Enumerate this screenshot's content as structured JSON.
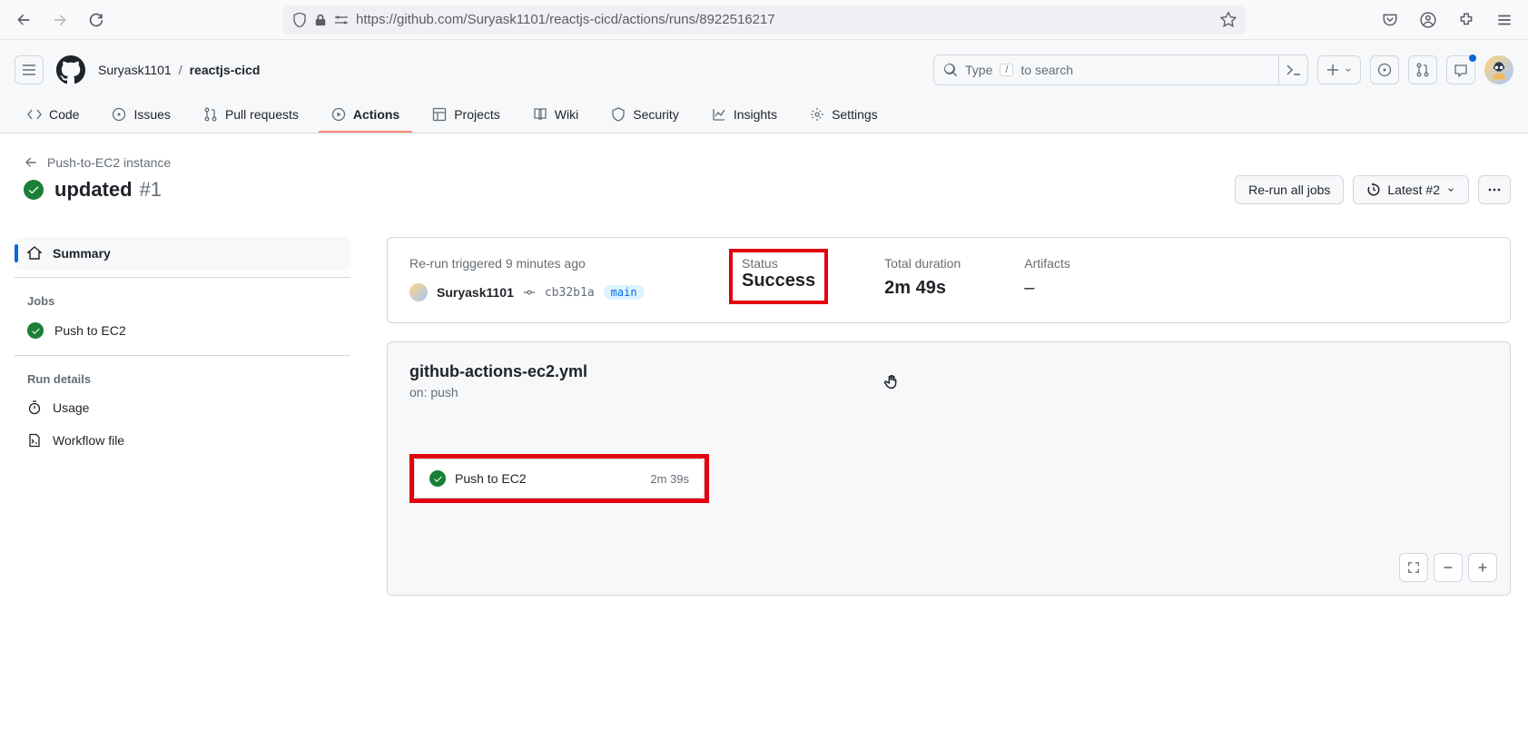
{
  "browser": {
    "url": "https://github.com/Suryask1101/reactjs-cicd/actions/runs/8922516217"
  },
  "breadcrumb": {
    "owner": "Suryask1101",
    "sep": "/",
    "repo": "reactjs-cicd"
  },
  "search": {
    "prefix": "Type",
    "key": "/",
    "suffix": "to search"
  },
  "repo_nav": {
    "code": "Code",
    "issues": "Issues",
    "pulls": "Pull requests",
    "actions": "Actions",
    "projects": "Projects",
    "wiki": "Wiki",
    "security": "Security",
    "insights": "Insights",
    "settings": "Settings"
  },
  "workflow_back": "Push-to-EC2 instance",
  "run": {
    "title": "updated",
    "number": "#1",
    "rerun_btn": "Re-run all jobs",
    "latest_btn": "Latest #2"
  },
  "sidebar": {
    "summary": "Summary",
    "jobs_heading": "Jobs",
    "job1": "Push to EC2",
    "details_heading": "Run details",
    "usage": "Usage",
    "workflow_file": "Workflow file"
  },
  "meta": {
    "triggered_label": "Re-run triggered 9 minutes ago",
    "user": "Suryask1101",
    "sha": "cb32b1a",
    "branch": "main",
    "status_label": "Status",
    "status_value": "Success",
    "duration_label": "Total duration",
    "duration_value": "2m 49s",
    "artifacts_label": "Artifacts",
    "artifacts_value": "–"
  },
  "panel": {
    "file": "github-actions-ec2.yml",
    "on": "on: push",
    "job_name": "Push to EC2",
    "job_duration": "2m 39s"
  }
}
